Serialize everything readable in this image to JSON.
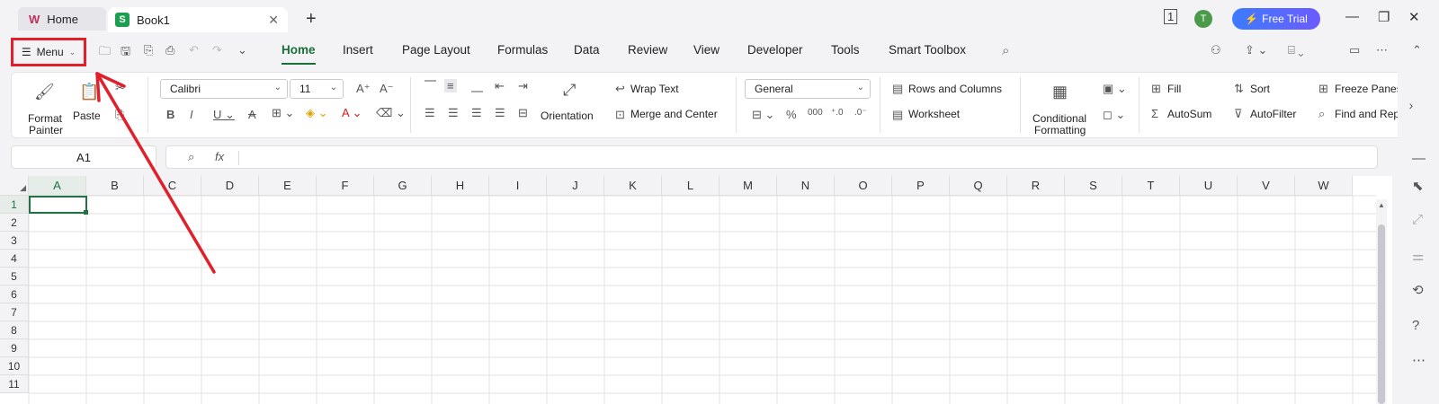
{
  "tabs": {
    "home": "Home",
    "book": "Book1"
  },
  "header": {
    "free_trial": "Free Trial",
    "avatar": "T"
  },
  "menu": {
    "label": "Menu"
  },
  "nav": [
    "Home",
    "Insert",
    "Page Layout",
    "Formulas",
    "Data",
    "Review",
    "View",
    "Developer",
    "Tools",
    "Smart Toolbox"
  ],
  "ribbon": {
    "format_painter_1": "Format",
    "format_painter_2": "Painter",
    "paste": "Paste",
    "font": "Calibri",
    "font_size": "11",
    "wrap_text": "Wrap Text",
    "merge_center": "Merge and Center",
    "orientation": "Orientation",
    "number_format": "General",
    "rows_columns": "Rows and Columns",
    "worksheet": "Worksheet",
    "cond_format_1": "Conditional",
    "cond_format_2": "Formatting",
    "fill": "Fill",
    "sort": "Sort",
    "freeze": "Freeze Panes",
    "autosum": "AutoSum",
    "autofilter": "AutoFilter",
    "find": "Find and Repl"
  },
  "formula": {
    "cell_ref": "A1",
    "fx": "fx"
  },
  "columns": [
    "A",
    "B",
    "C",
    "D",
    "E",
    "F",
    "G",
    "H",
    "I",
    "J",
    "K",
    "L",
    "M",
    "N",
    "O",
    "P",
    "Q",
    "R",
    "S",
    "T",
    "U",
    "V",
    "W"
  ],
  "rows": [
    "1",
    "2",
    "3",
    "4",
    "5",
    "6",
    "7",
    "8",
    "9",
    "10",
    "11"
  ],
  "colors": {
    "accent": "#1b6e3a",
    "annotation": "#e0202a"
  }
}
